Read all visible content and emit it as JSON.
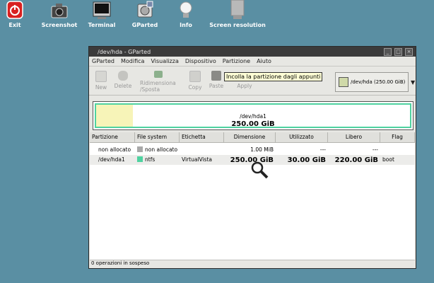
{
  "launcher": [
    {
      "label": "Exit",
      "icon": "power-icon"
    },
    {
      "label": "Screenshot",
      "icon": "camera-icon"
    },
    {
      "label": "Terminal",
      "icon": "terminal-icon"
    },
    {
      "label": "GParted",
      "icon": "gparted-icon"
    },
    {
      "label": "Info",
      "icon": "lightbulb-icon"
    },
    {
      "label": "Screen resolution",
      "icon": "monitor-icon"
    }
  ],
  "window": {
    "title": "/dev/hda - GParted",
    "menu": [
      "GParted",
      "Modifica",
      "Visualizza",
      "Dispositivo",
      "Partizione",
      "Aiuto"
    ],
    "toolbar": {
      "new": "New",
      "delete": "Delete",
      "resize_line1": "Ridimensiona",
      "resize_line2": "/Sposta",
      "copy": "Copy",
      "paste": "Paste",
      "apply": "Apply"
    },
    "tooltip": "Incolla la partizione dagli appunti",
    "device_selector": {
      "device": "/dev/hda",
      "size": "(250.00 GiB)"
    },
    "disk_map": {
      "name": "/dev/hda1",
      "size": "250.00 GiB"
    },
    "columns": [
      "Partizione",
      "File system",
      "Etichetta",
      "Dimensione",
      "Utilizzato",
      "Libero",
      "Flag"
    ],
    "rows": [
      {
        "partition": "non allocato",
        "fs": "non allocato",
        "fs_color": "#a8a8a8",
        "label": "",
        "size": "1.00 MiB",
        "used": "---",
        "free": "---",
        "flag": ""
      },
      {
        "partition": "/dev/hda1",
        "fs": "ntfs",
        "fs_color": "#4fd2a0",
        "label": "VirtualVista",
        "size": "250.00 GiB",
        "used": "30.00 GiB",
        "free": "220.00 GiB",
        "flag": "boot"
      }
    ],
    "status": "0 operazioni in sospeso"
  }
}
